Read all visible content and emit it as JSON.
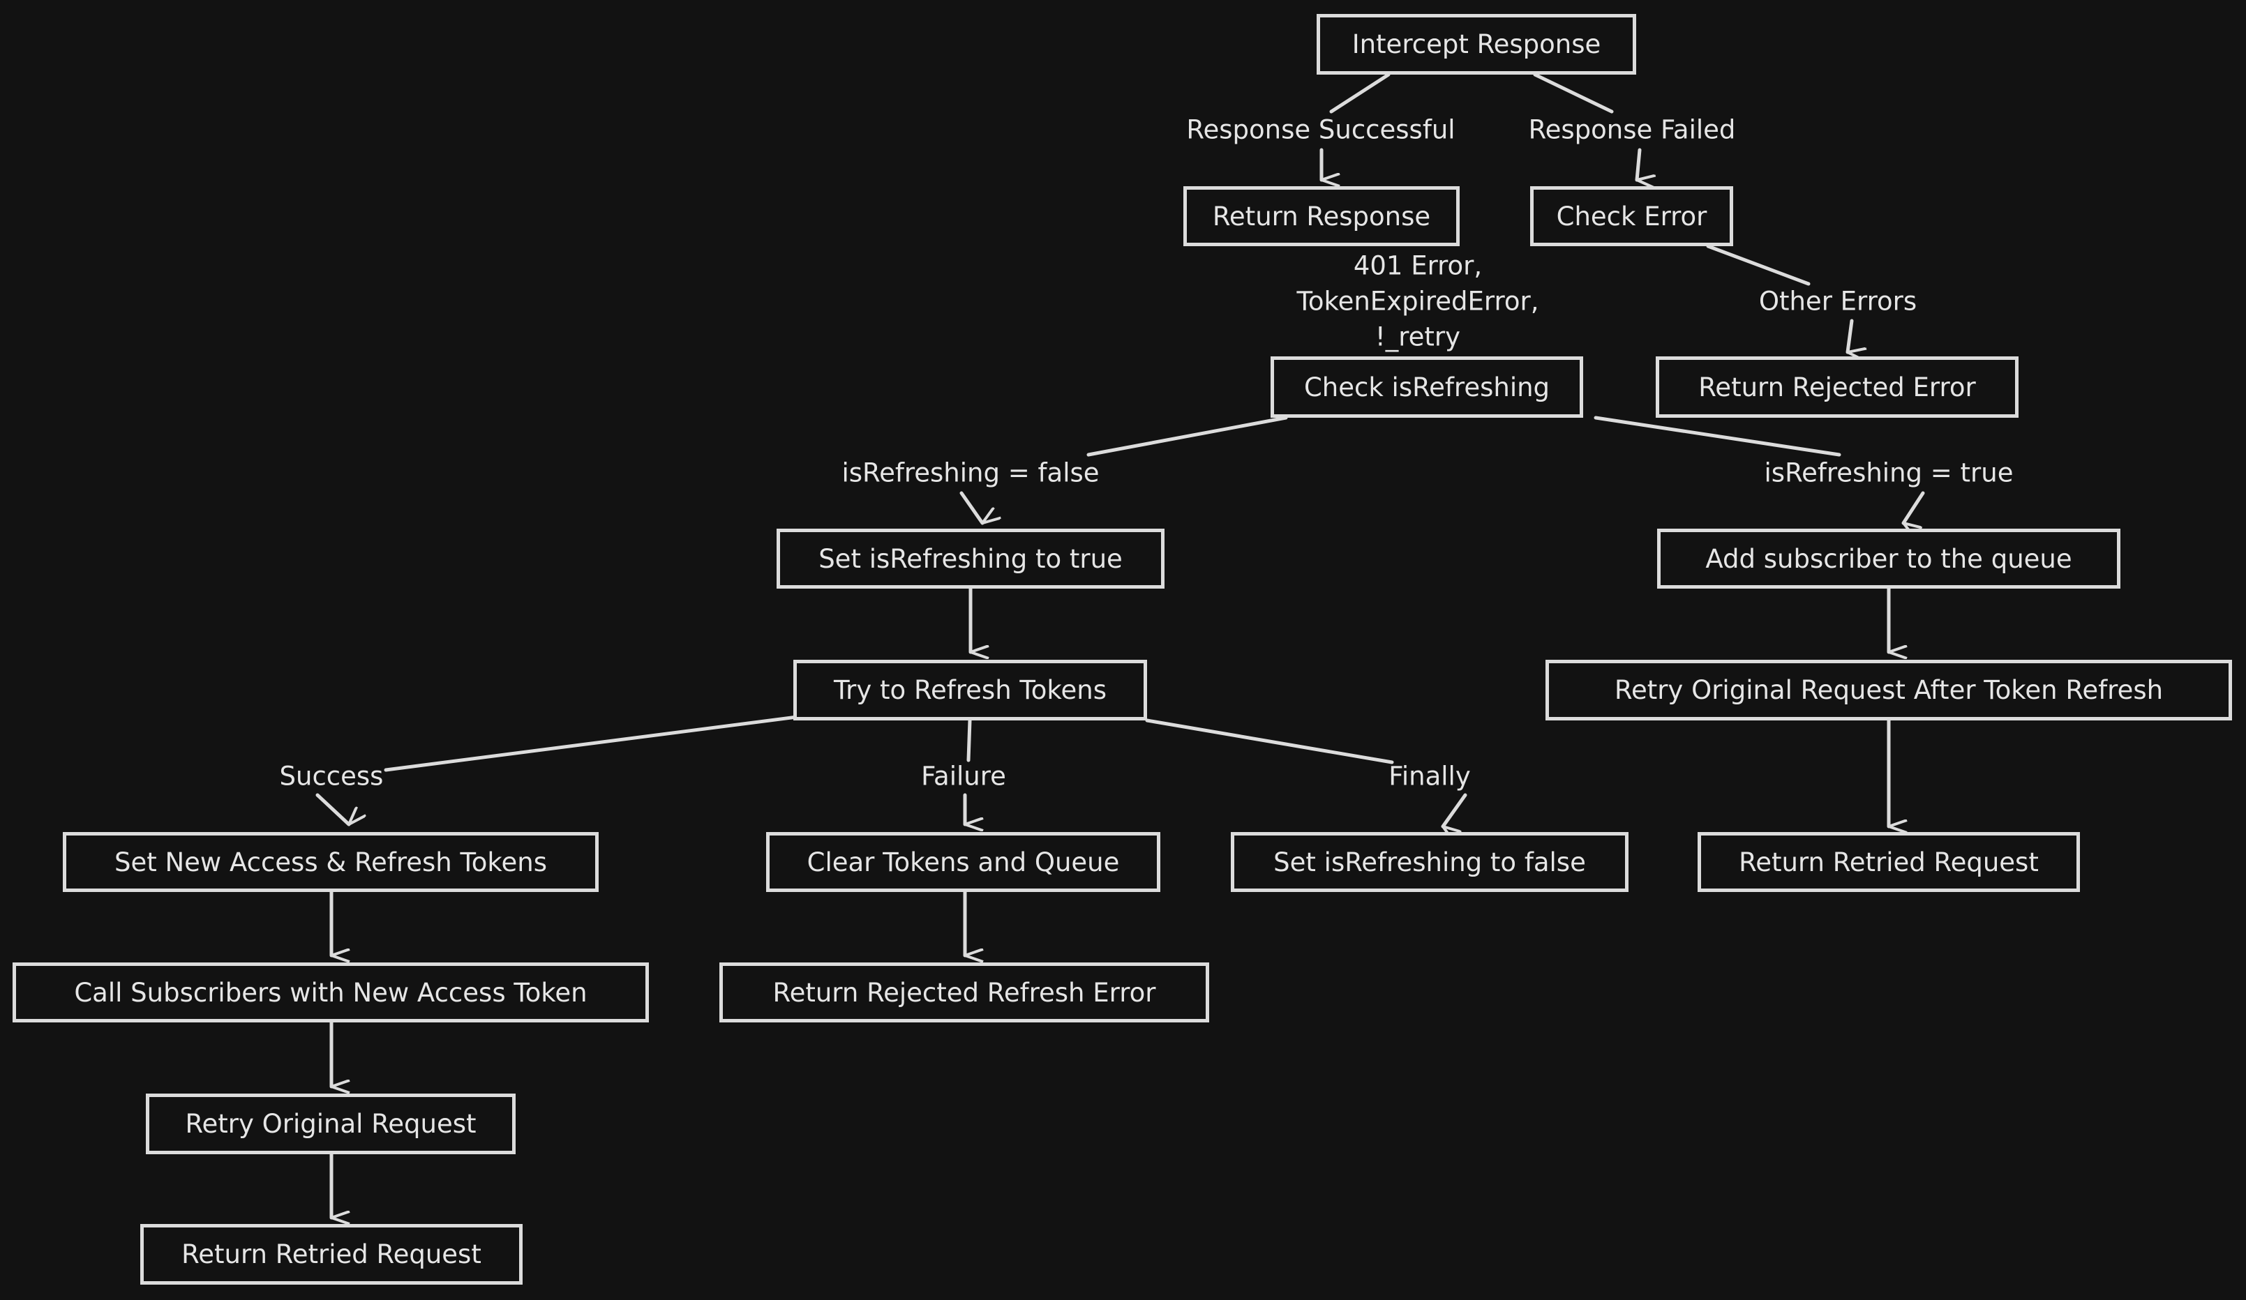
{
  "diagram": {
    "colors": {
      "background": "#121212",
      "stroke": "#dcdcdc",
      "text": "#e6e6e6"
    },
    "nodes": {
      "intercept_response": "Intercept Response",
      "return_response": "Return Response",
      "check_error": "Check Error",
      "check_is_refreshing": "Check isRefreshing",
      "return_rejected_error": "Return Rejected Error",
      "set_refreshing_true": "Set isRefreshing to true",
      "add_subscriber": "Add subscriber to the queue",
      "try_refresh": "Try to Refresh Tokens",
      "retry_after_refresh": "Retry Original Request After Token Refresh",
      "set_new_tokens": "Set New Access & Refresh Tokens",
      "clear_tokens": "Clear Tokens and Queue",
      "set_refreshing_false": "Set isRefreshing to false",
      "return_retried_right": "Return Retried Request",
      "call_subscribers": "Call Subscribers with New Access Token",
      "return_rejected_refresh": "Return Rejected Refresh Error",
      "retry_original": "Retry Original Request",
      "return_retried_left": "Return Retried Request"
    },
    "edge_labels": {
      "response_successful": "Response Successful",
      "response_failed": "Response Failed",
      "token_error_line1": "401 Error,",
      "token_error_line2": "TokenExpiredError,",
      "token_error_line3": "!_retry",
      "other_errors": "Other Errors",
      "refreshing_false": "isRefreshing = false",
      "refreshing_true": "isRefreshing = true",
      "success": "Success",
      "failure": "Failure",
      "finally": "Finally"
    }
  }
}
